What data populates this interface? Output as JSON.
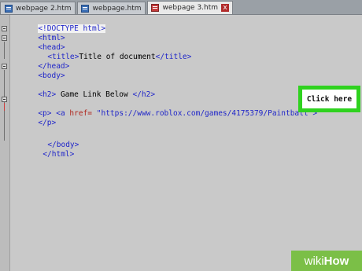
{
  "tabs": [
    {
      "label": "webpage 2.htm",
      "icon": "html-file-icon",
      "active": false
    },
    {
      "label": "webpage.htm",
      "icon": "html-file-icon",
      "active": false
    },
    {
      "label": "webpage 3.htm",
      "icon": "html-file-icon",
      "active": true,
      "close": "x"
    }
  ],
  "code": {
    "line1": "<!DOCTYPE html>",
    "line2": "<html>",
    "line3": "<head>",
    "line4_open": "<title>",
    "line4_text": "Title of document",
    "line4_close": "</title>",
    "line5": "</head>",
    "line6": "<body>",
    "line7_open": "<h2>",
    "line7_text": " Game Link Below ",
    "line7_close": "</h2>",
    "line8_p": "<p>",
    "line8_a": "<a",
    "line8_attr": "href=",
    "line8_url": "\"https://www.roblox.com/games/4175379/Paintball\"",
    "line8_end": ">",
    "line9": "</p>",
    "line10": "</body>",
    "line11": "</html>"
  },
  "highlight": {
    "label": "Click here",
    "color": "#2fd21f"
  },
  "watermark": {
    "wiki": "wiki",
    "how": "How"
  },
  "colors": {
    "tag": "#1f25c9",
    "attr": "#b0251c",
    "string": "#1f25c9",
    "highlight_border": "#2fd21f",
    "watermark_bg": "#7bbf47"
  }
}
